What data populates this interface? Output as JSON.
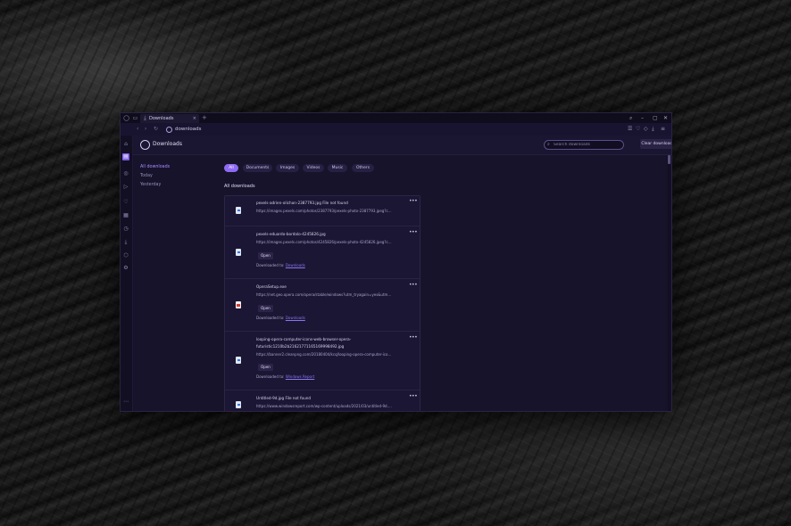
{
  "tab": {
    "title": "Downloads",
    "close": "×",
    "add": "+"
  },
  "address": {
    "url": "downloads"
  },
  "header": {
    "title": "Downloads",
    "search_placeholder": "Search downloads",
    "clear_label": "Clear downloads"
  },
  "left_nav": [
    "All downloads",
    "Today",
    "Yesterday"
  ],
  "filters": [
    "All",
    "Documents",
    "Images",
    "Videos",
    "Music",
    "Others"
  ],
  "section_title": "All downloads",
  "items": [
    {
      "name": "pexels-adrien-olichon-2387793.jpg   File not found",
      "url": "https://images.pexels.com/photos/2387793/pexels-photo-2387793.jpeg?cs=srgb&dl=pexels-adrien",
      "type": "image"
    },
    {
      "name": "pexels-eduardo-bordalo-4245826.jpg",
      "url": "https://images.pexels.com/photos/4245826/pexels-photo-4245826.jpeg?cs=srgb&dl=pexels",
      "open": "Open",
      "downloaded_to": "Downloaded to:",
      "folder": "Downloads",
      "type": "image"
    },
    {
      "name": "OperaSetup.exe",
      "url": "https://net.geo.opera.com/opera/stable/windows?utm_tryagain=yes&utm_source=google",
      "open": "Open",
      "downloaded_to": "Downloaded to:",
      "folder": "Downloads",
      "type": "exe"
    },
    {
      "name": "looping-opera-computer-icons-web-browser-opera-",
      "name2": "futuristic1210b2b21621771165169998492.jpg",
      "url": "https://banner2.cleanpng.com/20180404/kcq/looping-opera-computer-icons-web-browser",
      "open": "Open",
      "downloaded_to": "Downloaded to:",
      "folder": "Windows Report",
      "type": "image"
    },
    {
      "name": "Untitled-9d.jpg   File not found",
      "url": "https://www.windowsreport.com/wp-content/uploads/2021/03/untitled-9d.jpg",
      "type": "image"
    }
  ],
  "more_icon": "•••"
}
